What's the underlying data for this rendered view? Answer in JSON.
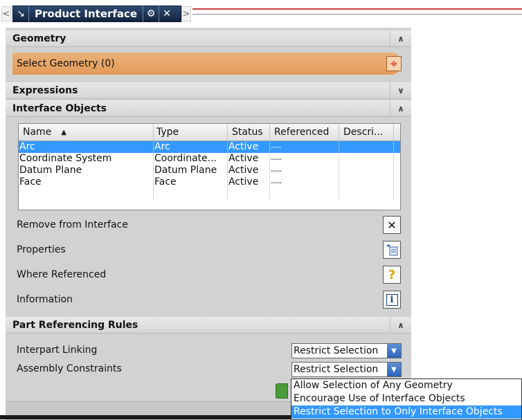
{
  "titlebar": {
    "title": "Product Interface",
    "nav_left": "<",
    "nav_right": ">",
    "pin_icon": "pin-icon",
    "gear_icon": "gear-icon",
    "close_icon": "close-icon"
  },
  "sections": {
    "geometry": "Geometry",
    "expressions": "Expressions",
    "interface_objects": "Interface Objects",
    "part_referencing_rules": "Part Referencing Rules"
  },
  "select_geometry": {
    "label": "Select Geometry (0)"
  },
  "table": {
    "columns": [
      "Name",
      "Type",
      "Status",
      "Referenced",
      "Descri..."
    ],
    "sort_indicator": "▲",
    "rows": [
      {
        "name": "Arc",
        "type": "Arc",
        "status": "Active",
        "referenced": "----",
        "description": ""
      },
      {
        "name": "Coordinate System",
        "type": "Coordinate...",
        "status": "Active",
        "referenced": "----",
        "description": ""
      },
      {
        "name": "Datum Plane",
        "type": "Datum Plane",
        "status": "Active",
        "referenced": "----",
        "description": ""
      },
      {
        "name": "Face",
        "type": "Face",
        "status": "Active",
        "referenced": "----",
        "description": ""
      }
    ]
  },
  "actions": {
    "remove": "Remove from Interface",
    "properties": "Properties",
    "where_referenced": "Where Referenced",
    "information": "Information"
  },
  "rules": {
    "interpart_label": "Interpart Linking",
    "interpart_value": "Restrict Selection",
    "assembly_label": "Assembly Constraints",
    "assembly_value": "Restrict Selection"
  },
  "dropdown_options": [
    "Allow Selection of Any Geometry",
    "Encourage Use of Interface Objects",
    "Restrict Selection to Only Interface Objects"
  ],
  "colors": {
    "accent_selected": "#3399ff",
    "select_geometry_bar": "#e39a57",
    "title_tab": "#1c2f50"
  }
}
